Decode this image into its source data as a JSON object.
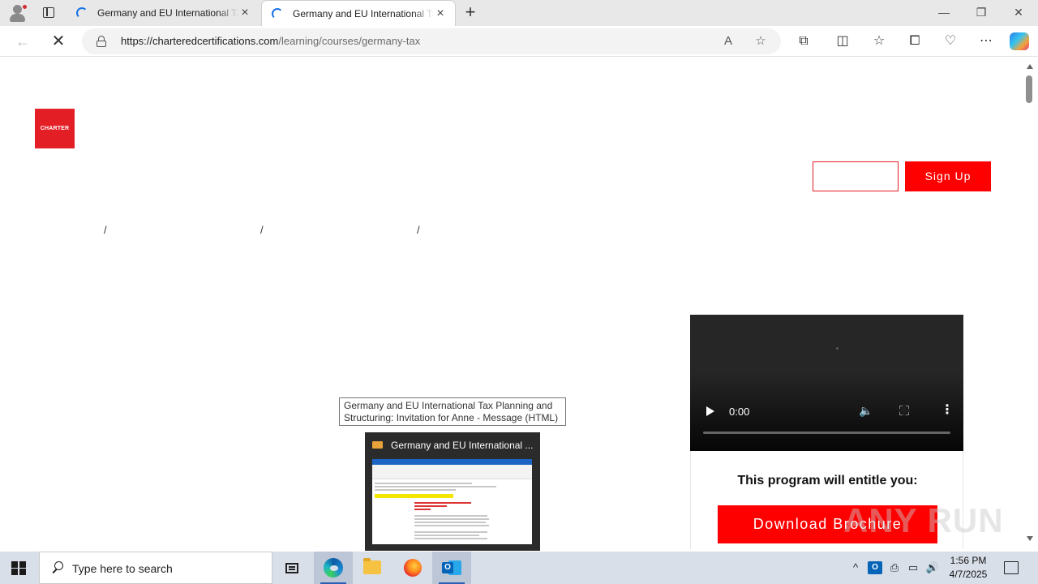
{
  "browser": {
    "tabs": [
      {
        "title": "Germany and EU International Tax Planning and Structuring",
        "active": false
      },
      {
        "title": "Germany and EU International Tax Planning and Structuring",
        "active": true
      }
    ],
    "new_tab_symbol": "+",
    "window_controls": {
      "minimize": "—",
      "restore": "❐",
      "close": "✕"
    },
    "address": {
      "host": "https://charteredcertifications.com",
      "path": "/learning/courses/germany-tax"
    },
    "toolbar_icons": [
      "read-aloud-icon",
      "favorite-star-icon",
      "extensions-icon",
      "split-screen-icon",
      "favorites-icon",
      "collections-icon",
      "browser-essentials-icon",
      "more-icon",
      "copilot-icon"
    ]
  },
  "page": {
    "logo_text": "CHARTER",
    "signup_label": "Sign Up",
    "breadcrumb_separators": [
      "/",
      "/",
      "/"
    ],
    "video": {
      "time": "0:00"
    },
    "entitle_text": "This program will entitle you:",
    "download_label": "Download Brochure",
    "watermark_text": "ANY RUN"
  },
  "taskbar_preview": {
    "tooltip": "Germany and EU International Tax Planning and Structuring: Invitation for Anne - Message (HTML)",
    "label": "Germany and EU International ..."
  },
  "taskbar": {
    "search_placeholder": "Type here to search",
    "time": "1:56 PM",
    "date": "4/7/2025",
    "accent": "#2b5fb3"
  },
  "colors": {
    "brand_red": "#ff0000",
    "logo_red": "#e31e24"
  }
}
